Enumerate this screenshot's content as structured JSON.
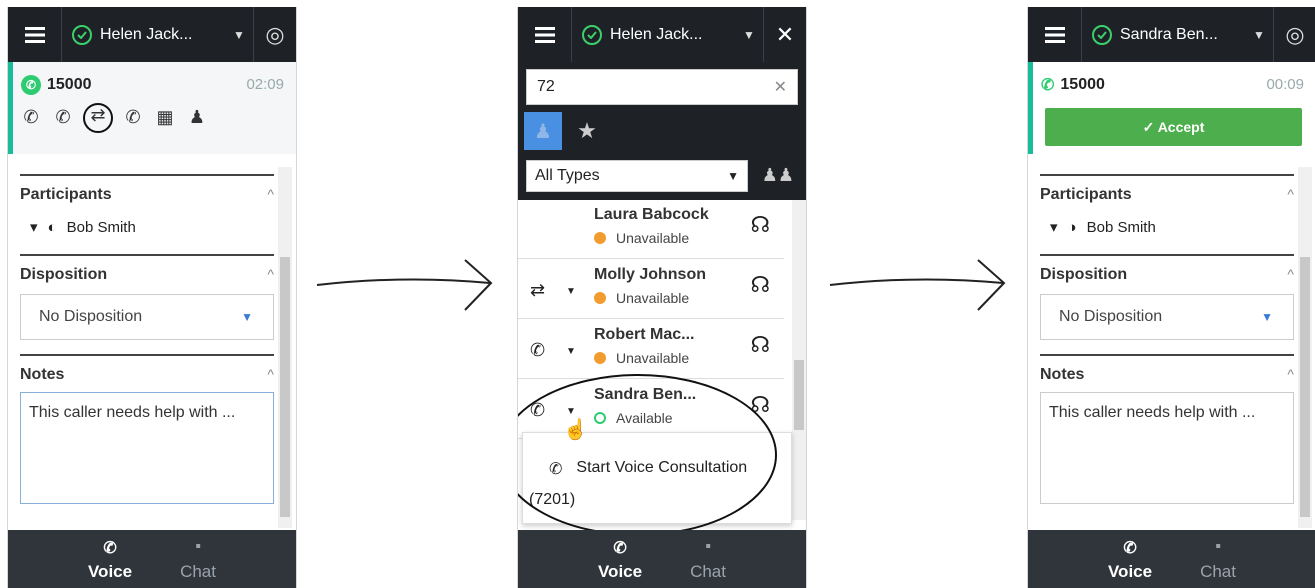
{
  "panel1": {
    "agent_name": "Helen Jack...",
    "call_number": "15000",
    "call_time": "02:09",
    "participants_title": "Participants",
    "participant_name": "Bob Smith",
    "disposition_title": "Disposition",
    "disposition_value": "No Disposition",
    "notes_title": "Notes",
    "notes_text": "This caller needs help with ...",
    "tab_voice": "Voice",
    "tab_chat": "Chat"
  },
  "panel2": {
    "agent_name": "Helen Jack...",
    "search_value": "72",
    "filter_value": "All Types",
    "contacts": [
      {
        "name": "Laura Babcock",
        "status": "Unavailable"
      },
      {
        "name": "Molly Johnson",
        "status": "Unavailable"
      },
      {
        "name": "Robert Mac...",
        "status": "Unavailable"
      },
      {
        "name": "Sandra Ben...",
        "status": "Available"
      }
    ],
    "menu_item": "Start Voice Consultation",
    "menu_sub": "(7201)",
    "tab_voice": "Voice",
    "tab_chat": "Chat"
  },
  "panel3": {
    "agent_name": "Sandra Ben...",
    "call_number": "15000",
    "call_time": "00:09",
    "accept_label": "✓ Accept",
    "participants_title": "Participants",
    "participant_name": "Bob Smith",
    "disposition_title": "Disposition",
    "disposition_value": "No Disposition",
    "notes_title": "Notes",
    "notes_text": "This caller needs help with ...",
    "tab_voice": "Voice",
    "tab_chat": "Chat"
  }
}
